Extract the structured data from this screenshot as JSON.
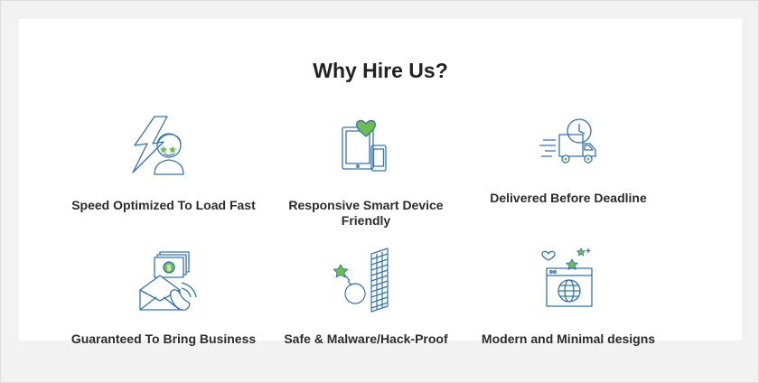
{
  "section": {
    "title": "Why Hire Us?"
  },
  "features": [
    {
      "label": "Speed Optimized To Load Fast",
      "icon": "speed-face-icon"
    },
    {
      "label": "Responsive Smart Device Friendly",
      "icon": "devices-heart-icon"
    },
    {
      "label": "Delivered Before Deadline",
      "icon": "delivery-truck-clock-icon"
    },
    {
      "label": "Guaranteed To Bring Business",
      "icon": "envelope-money-phone-icon"
    },
    {
      "label": "Safe & Malware/Hack-Proof",
      "icon": "firewall-bomb-icon"
    },
    {
      "label": "Modern and Minimal designs",
      "icon": "browser-globe-icon"
    }
  ],
  "colors": {
    "stroke": "#2f73b6",
    "accent": "#6cc04a",
    "text": "#2b2b2b"
  }
}
